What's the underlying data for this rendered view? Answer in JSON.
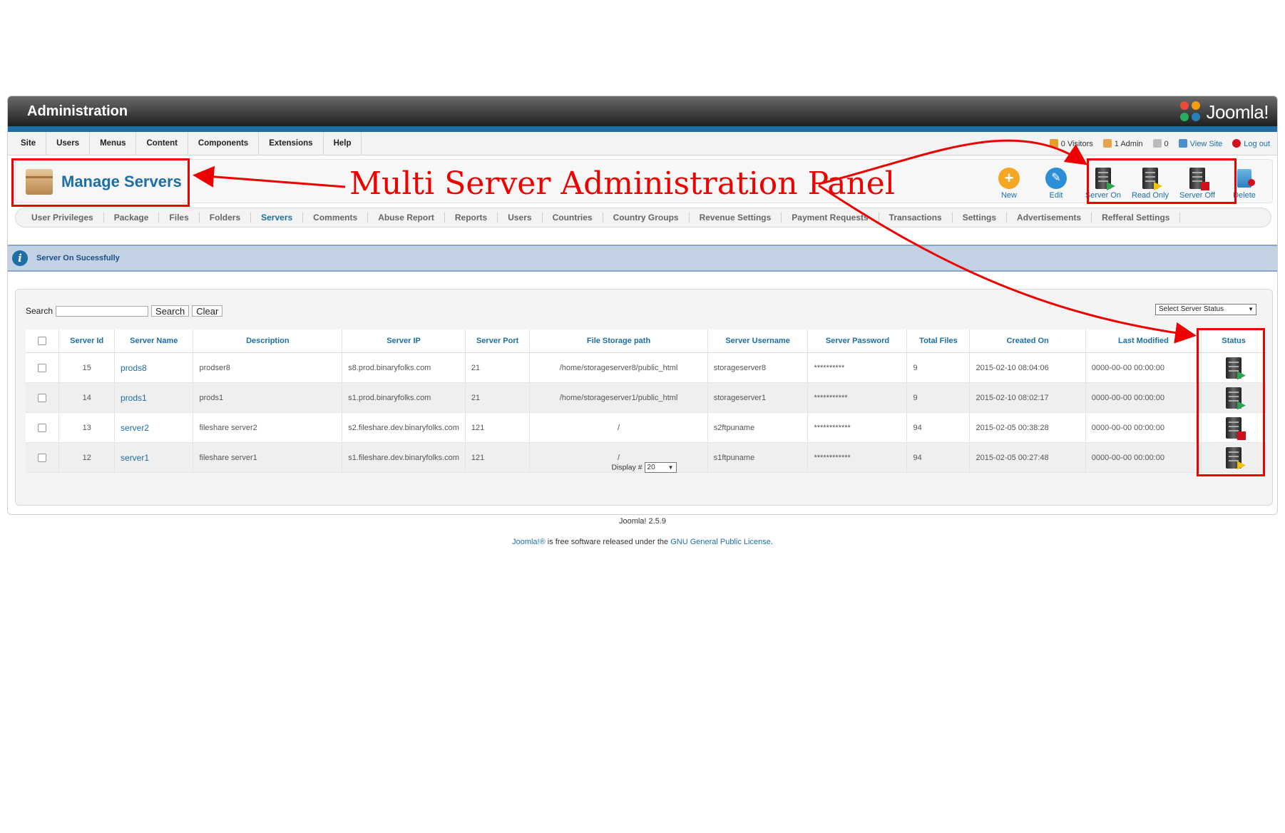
{
  "header": {
    "title": "Administration",
    "logo_text": "Joomla!"
  },
  "menu": [
    "Site",
    "Users",
    "Menus",
    "Content",
    "Components",
    "Extensions",
    "Help"
  ],
  "status": {
    "visitors": "0 Visitors",
    "admins": "1 Admin",
    "messages": "0",
    "view_site": "View Site",
    "logout": "Log out"
  },
  "page_title": "Manage Servers",
  "toolbar": [
    {
      "label": "New",
      "icon": "new-icon"
    },
    {
      "label": "Edit",
      "icon": "edit-icon"
    },
    {
      "label": "Server On",
      "icon": "server-on-icon"
    },
    {
      "label": "Read Only",
      "icon": "server-readonly-icon"
    },
    {
      "label": "Server Off",
      "icon": "server-off-icon"
    },
    {
      "label": "Delete",
      "icon": "trash-icon"
    }
  ],
  "submenu": [
    "User Privileges",
    "Package",
    "Files",
    "Folders",
    "Servers",
    "Comments",
    "Abuse Report",
    "Reports",
    "Users",
    "Countries",
    "Country Groups",
    "Revenue Settings",
    "Payment Requests",
    "Transactions",
    "Settings",
    "Advertisements",
    "Refferal Settings"
  ],
  "submenu_active": "Servers",
  "message": "Server On Sucessfully",
  "search": {
    "label": "Search",
    "value": "",
    "search_button": "Search",
    "clear_button": "Clear"
  },
  "status_filter": "Select Server Status",
  "table": {
    "columns": [
      "Server Id",
      "Server Name",
      "Description",
      "Server IP",
      "Server Port",
      "File Storage path",
      "Server Username",
      "Server Password",
      "Total Files",
      "Created On",
      "Last Modified",
      "Status"
    ],
    "rows": [
      {
        "id": "15",
        "name": "prods8",
        "description": "prodser8",
        "ip": "s8.prod.binaryfolks.com",
        "port": "21",
        "path": "/home/storageserver8/public_html",
        "username": "storageserver8",
        "password": "**********",
        "files": "9",
        "created": "2015-02-10 08:04:06",
        "modified": "0000-00-00 00:00:00",
        "status": "on"
      },
      {
        "id": "14",
        "name": "prods1",
        "description": "prods1",
        "ip": "s1.prod.binaryfolks.com",
        "port": "21",
        "path": "/home/storageserver1/public_html",
        "username": "storageserver1",
        "password": "***********",
        "files": "9",
        "created": "2015-02-10 08:02:17",
        "modified": "0000-00-00 00:00:00",
        "status": "on"
      },
      {
        "id": "13",
        "name": "server2",
        "description": "fileshare server2",
        "ip": "s2.fileshare.dev.binaryfolks.com",
        "port": "121",
        "path": "/",
        "username": "s2ftpuname",
        "password": "************",
        "files": "94",
        "created": "2015-02-05 00:38:28",
        "modified": "0000-00-00 00:00:00",
        "status": "off"
      },
      {
        "id": "12",
        "name": "server1",
        "description": "fileshare server1",
        "ip": "s1.fileshare.dev.binaryfolks.com",
        "port": "121",
        "path": "/",
        "username": "s1ftpuname",
        "password": "************",
        "files": "94",
        "created": "2015-02-05 00:27:48",
        "modified": "0000-00-00 00:00:00",
        "status": "readonly"
      }
    ]
  },
  "display": {
    "label": "Display #",
    "value": "20"
  },
  "footer": {
    "version": "Joomla! 2.5.9",
    "joomla_link": "Joomla!®",
    "license_text": " is free software released under the ",
    "license_link": "GNU General Public License",
    "period": "."
  },
  "annotation": "Multi Server Administration Panel",
  "colors": {
    "accent": "#1c6ea4",
    "annotation": "#e00000",
    "on": "#2ea44f",
    "off": "#d0101c",
    "readonly": "#f2c200"
  }
}
